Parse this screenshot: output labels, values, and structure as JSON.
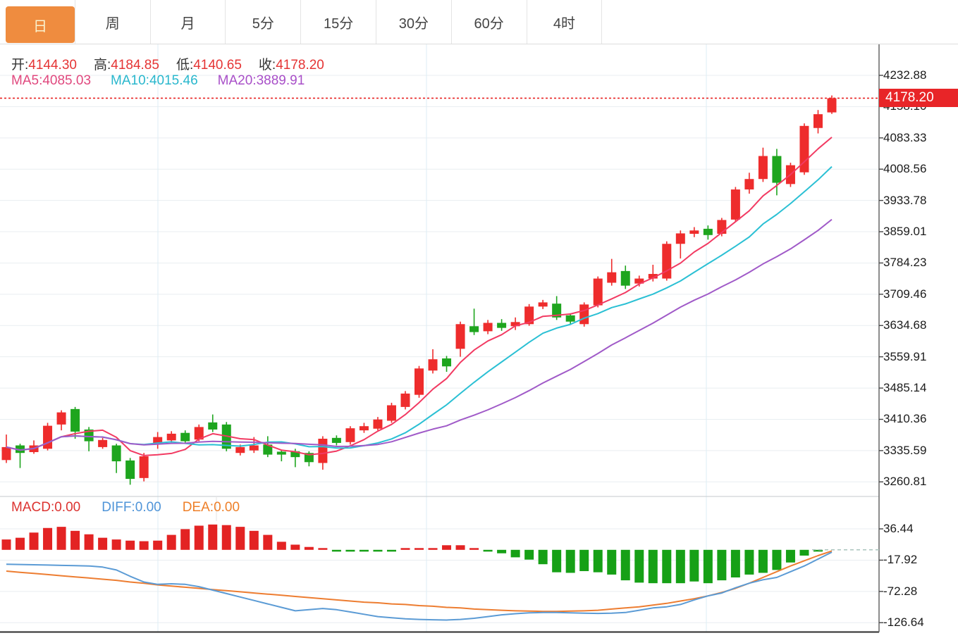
{
  "tabs": {
    "active_key": "day",
    "items": [
      {
        "key": "day",
        "label": "日"
      },
      {
        "key": "week",
        "label": "周"
      },
      {
        "key": "month",
        "label": "月"
      },
      {
        "key": "5min",
        "label": "5分"
      },
      {
        "key": "15min",
        "label": "15分"
      },
      {
        "key": "30min",
        "label": "30分"
      },
      {
        "key": "60min",
        "label": "60分"
      },
      {
        "key": "4hour",
        "label": "4时"
      }
    ]
  },
  "legend": {
    "ohlc": [
      {
        "label": "开:",
        "value": "4144.30"
      },
      {
        "label": "高:",
        "value": "4184.85"
      },
      {
        "label": "低:",
        "value": "4140.65"
      },
      {
        "label": "收:",
        "value": "4178.20"
      }
    ],
    "ohlc_value_color": "#e53434",
    "ma": [
      {
        "label": "MA5: ",
        "value": "4085.03",
        "color": "#e0487e"
      },
      {
        "label": "MA10: ",
        "value": "4015.46",
        "color": "#29b7cd"
      },
      {
        "label": "MA20: ",
        "value": "3889.91",
        "color": "#a84fc8"
      }
    ]
  },
  "macd_legend": [
    {
      "label": "MACD:",
      "value": "0.00",
      "color": "#dc3330"
    },
    {
      "label": "DIFF:",
      "value": "0.00",
      "color": "#4f94d8"
    },
    {
      "label": "DEA:",
      "value": "0.00",
      "color": "#ee7f28"
    }
  ],
  "price_tag": {
    "text": "4178.20",
    "bg": "#e82528",
    "fg": "#ffffff"
  },
  "chart_data": {
    "type": "candlestick",
    "panels": [
      "price",
      "macd"
    ],
    "title": "",
    "price_axis_ticks": [
      "4232.88",
      "4158.10",
      "4083.33",
      "4008.56",
      "3933.78",
      "3859.01",
      "3784.23",
      "3709.46",
      "3634.68",
      "3559.91",
      "3485.14",
      "3410.36",
      "3335.59",
      "3260.81"
    ],
    "price_axis_range": [
      3260.81,
      4232.88
    ],
    "macd_axis_ticks": [
      "36.44",
      "-17.92",
      "-72.28",
      "-126.64"
    ],
    "macd_axis_range": [
      -126.64,
      36.44
    ],
    "last_price_line": 4178.2,
    "grid": true,
    "legend_position": "top-left",
    "ma_periods": [
      5,
      10,
      20
    ],
    "candles": [
      [
        3313,
        3344,
        3374,
        3306
      ],
      [
        3348,
        3330,
        3352,
        3294
      ],
      [
        3332,
        3348,
        3360,
        3328
      ],
      [
        3340,
        3395,
        3402,
        3336
      ],
      [
        3398,
        3427,
        3432,
        3384
      ],
      [
        3435,
        3381,
        3440,
        3364
      ],
      [
        3386,
        3358,
        3392,
        3334
      ],
      [
        3344,
        3361,
        3366,
        3340
      ],
      [
        3348,
        3310,
        3352,
        3282
      ],
      [
        3312,
        3268,
        3318,
        3254
      ],
      [
        3270,
        3322,
        3330,
        3262
      ],
      [
        3352,
        3368,
        3380,
        3340
      ],
      [
        3360,
        3376,
        3382,
        3354
      ],
      [
        3378,
        3358,
        3384,
        3352
      ],
      [
        3362,
        3392,
        3398,
        3358
      ],
      [
        3403,
        3386,
        3422,
        3380
      ],
      [
        3398,
        3340,
        3404,
        3334
      ],
      [
        3330,
        3344,
        3350,
        3324
      ],
      [
        3336,
        3348,
        3368,
        3330
      ],
      [
        3350,
        3326,
        3370,
        3320
      ],
      [
        3333,
        3326,
        3338,
        3310
      ],
      [
        3334,
        3320,
        3340,
        3296
      ],
      [
        3330,
        3308,
        3334,
        3298
      ],
      [
        3306,
        3364,
        3370,
        3290
      ],
      [
        3366,
        3354,
        3372,
        3348
      ],
      [
        3356,
        3389,
        3394,
        3350
      ],
      [
        3384,
        3394,
        3402,
        3378
      ],
      [
        3388,
        3410,
        3416,
        3384
      ],
      [
        3407,
        3444,
        3450,
        3402
      ],
      [
        3440,
        3472,
        3478,
        3434
      ],
      [
        3469,
        3532,
        3538,
        3462
      ],
      [
        3527,
        3554,
        3578,
        3520
      ],
      [
        3556,
        3537,
        3562,
        3524
      ],
      [
        3579,
        3638,
        3644,
        3560
      ],
      [
        3633,
        3619,
        3675,
        3612
      ],
      [
        3621,
        3641,
        3648,
        3614
      ],
      [
        3641,
        3629,
        3650,
        3622
      ],
      [
        3633,
        3643,
        3654,
        3624
      ],
      [
        3638,
        3680,
        3686,
        3634
      ],
      [
        3680,
        3690,
        3696,
        3674
      ],
      [
        3687,
        3654,
        3705,
        3648
      ],
      [
        3659,
        3644,
        3664,
        3636
      ],
      [
        3638,
        3685,
        3690,
        3632
      ],
      [
        3683,
        3747,
        3752,
        3678
      ],
      [
        3737,
        3762,
        3794,
        3730
      ],
      [
        3765,
        3730,
        3778,
        3722
      ],
      [
        3735,
        3747,
        3754,
        3728
      ],
      [
        3747,
        3758,
        3780,
        3740
      ],
      [
        3747,
        3830,
        3836,
        3742
      ],
      [
        3830,
        3855,
        3862,
        3795
      ],
      [
        3854,
        3862,
        3870,
        3846
      ],
      [
        3866,
        3851,
        3874,
        3840
      ],
      [
        3854,
        3887,
        3892,
        3848
      ],
      [
        3888,
        3960,
        3966,
        3882
      ],
      [
        3960,
        3985,
        4000,
        3950
      ],
      [
        3985,
        4040,
        4060,
        3978
      ],
      [
        4040,
        3976,
        4057,
        3946
      ],
      [
        3973,
        4018,
        4024,
        3966
      ],
      [
        4001,
        4112,
        4118,
        3995
      ],
      [
        4107,
        4140,
        4150,
        4094
      ],
      [
        4144.3,
        4178.2,
        4184.85,
        4140.65
      ]
    ],
    "macd_hist": [
      18,
      21,
      30,
      38,
      40,
      33,
      27,
      21,
      18,
      16,
      15,
      16,
      26,
      36,
      42,
      44,
      43,
      40,
      33,
      26,
      14,
      9,
      5,
      3,
      -2,
      -2,
      -3,
      -3,
      -2,
      2,
      3,
      3,
      8,
      8,
      3,
      -3,
      -6,
      -13,
      -17,
      -25,
      -39,
      -40,
      -37,
      -39,
      -43,
      -53,
      -57,
      -58,
      -58,
      -58,
      -55,
      -58,
      -53,
      -48,
      -43,
      -40,
      -35,
      -22,
      -10,
      -3,
      0
    ],
    "diff_line": [
      -25,
      -25.5,
      -26,
      -26.5,
      -27,
      -27.5,
      -28,
      -30,
      -35,
      -46,
      -56,
      -60,
      -59,
      -60,
      -64,
      -70,
      -76,
      -82,
      -88,
      -94,
      -100,
      -106,
      -104,
      -102,
      -104,
      -108,
      -112,
      -116,
      -118,
      -120,
      -121,
      -121.5,
      -122,
      -121,
      -119,
      -116,
      -113,
      -111,
      -109.5,
      -109,
      -109,
      -109.5,
      -110,
      -110.5,
      -110,
      -109,
      -105,
      -101,
      -99,
      -95,
      -87,
      -80,
      -75,
      -66,
      -58,
      -52,
      -48,
      -38,
      -28,
      -16,
      -4
    ],
    "dea_line": [
      -37,
      -39,
      -41,
      -43,
      -45,
      -47,
      -49,
      -51,
      -53,
      -56,
      -58,
      -61,
      -63,
      -65,
      -67,
      -69,
      -71,
      -73,
      -75,
      -77,
      -79,
      -81,
      -83,
      -85,
      -87,
      -89,
      -91,
      -92,
      -94,
      -95,
      -97,
      -98,
      -100,
      -101,
      -103,
      -104,
      -105,
      -106,
      -106.5,
      -107,
      -107,
      -106.5,
      -106,
      -105,
      -103,
      -101,
      -99,
      -96,
      -93,
      -89,
      -85,
      -80,
      -74,
      -67,
      -58,
      -48,
      -38,
      -28,
      -19,
      -10,
      -2
    ],
    "colors": {
      "up": "#ee2c2c",
      "down": "#1ea51e",
      "ma5": "#f23a62",
      "ma10": "#2bc0d4",
      "ma20": "#a05ac8",
      "diff": "#5b9bd5",
      "dea": "#ed7d31",
      "grid": "#e9eef1",
      "vgrid": "#ddeef4",
      "axis_line": "#666666",
      "bottom_line": "#2b2b2b",
      "separator": "#c4cacd",
      "dotted_price": "#e82222",
      "macd_zero_dash": "#a9c4bd",
      "macd_up": "#e32323",
      "macd_down": "#16a016"
    }
  }
}
